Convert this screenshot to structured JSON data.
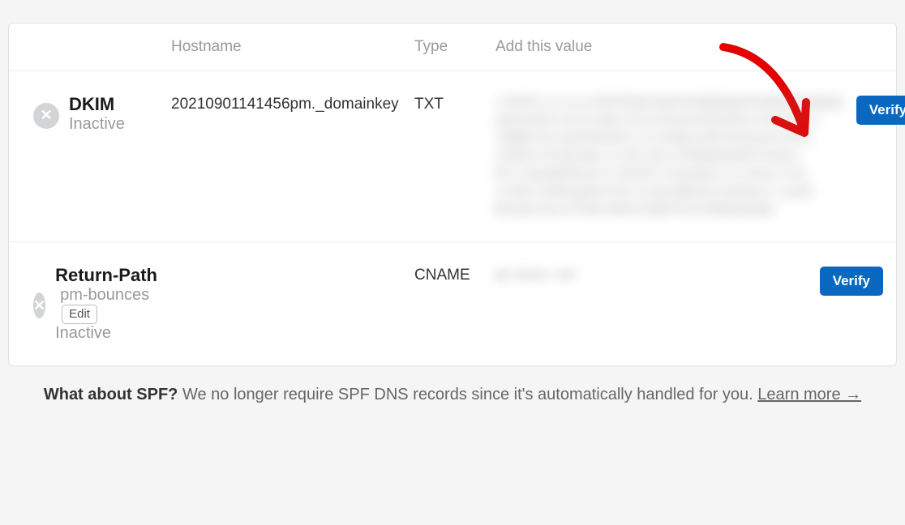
{
  "header": {
    "hostname": "Hostname",
    "type": "Type",
    "value": "Add this value"
  },
  "records": {
    "dkim": {
      "name": "DKIM",
      "state": "Inactive",
      "hostname": "20210901141456pm._domainkey",
      "type": "TXT",
      "verify_label": "Verify"
    },
    "return_path": {
      "name": "Return-Path",
      "subdomain": "pm-bounces",
      "state": "Inactive",
      "edit_label": "Edit",
      "type": "CNAME",
      "verify_label": "Verify"
    }
  },
  "footnote": {
    "lead": "What about SPF?",
    "body": " We no longer require SPF DNS records since it's automatically handled for you. ",
    "link": "Learn more →"
  },
  "colors": {
    "primary": "#0a68c1",
    "annotation": "#e30000"
  }
}
